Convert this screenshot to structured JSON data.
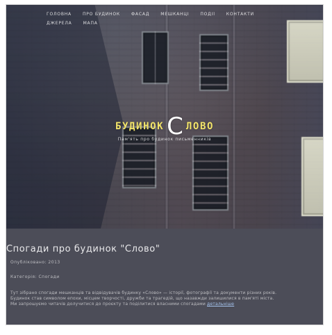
{
  "nav": {
    "items": [
      "Головна",
      "Про будинок",
      "Фасад",
      "Мешканці",
      "Події",
      "Контакти",
      "Джерела",
      "Мапа"
    ]
  },
  "hero": {
    "logo_left": "БУДИНОК",
    "logo_big": "С",
    "logo_right": "ЛОВО",
    "tagline": "Пам'ять про будинок письменників"
  },
  "article": {
    "title": "Спогади про будинок \"Слово\"",
    "meta": "Опубліковано: 2013",
    "meta2": "Категорія: Спогади",
    "excerpt_lines": [
      "Тут зібрано спогади мешканців та відвідувачів будинку «Слово» — історії, фотографії та документи різних років.",
      "Будинок став символом епохи, місцем творчості, дружби та трагедій, що назавжди залишилися в пам'яті міста.",
      "Ми запрошуємо читачів долучитися до проєкту та поділитися власними спогадами"
    ],
    "excerpt_link": "детальніше"
  },
  "colors": {
    "logo_yellow": "#f2e46a",
    "content_bg": "#4c4d58",
    "hero_overlay": "#3c4052"
  }
}
